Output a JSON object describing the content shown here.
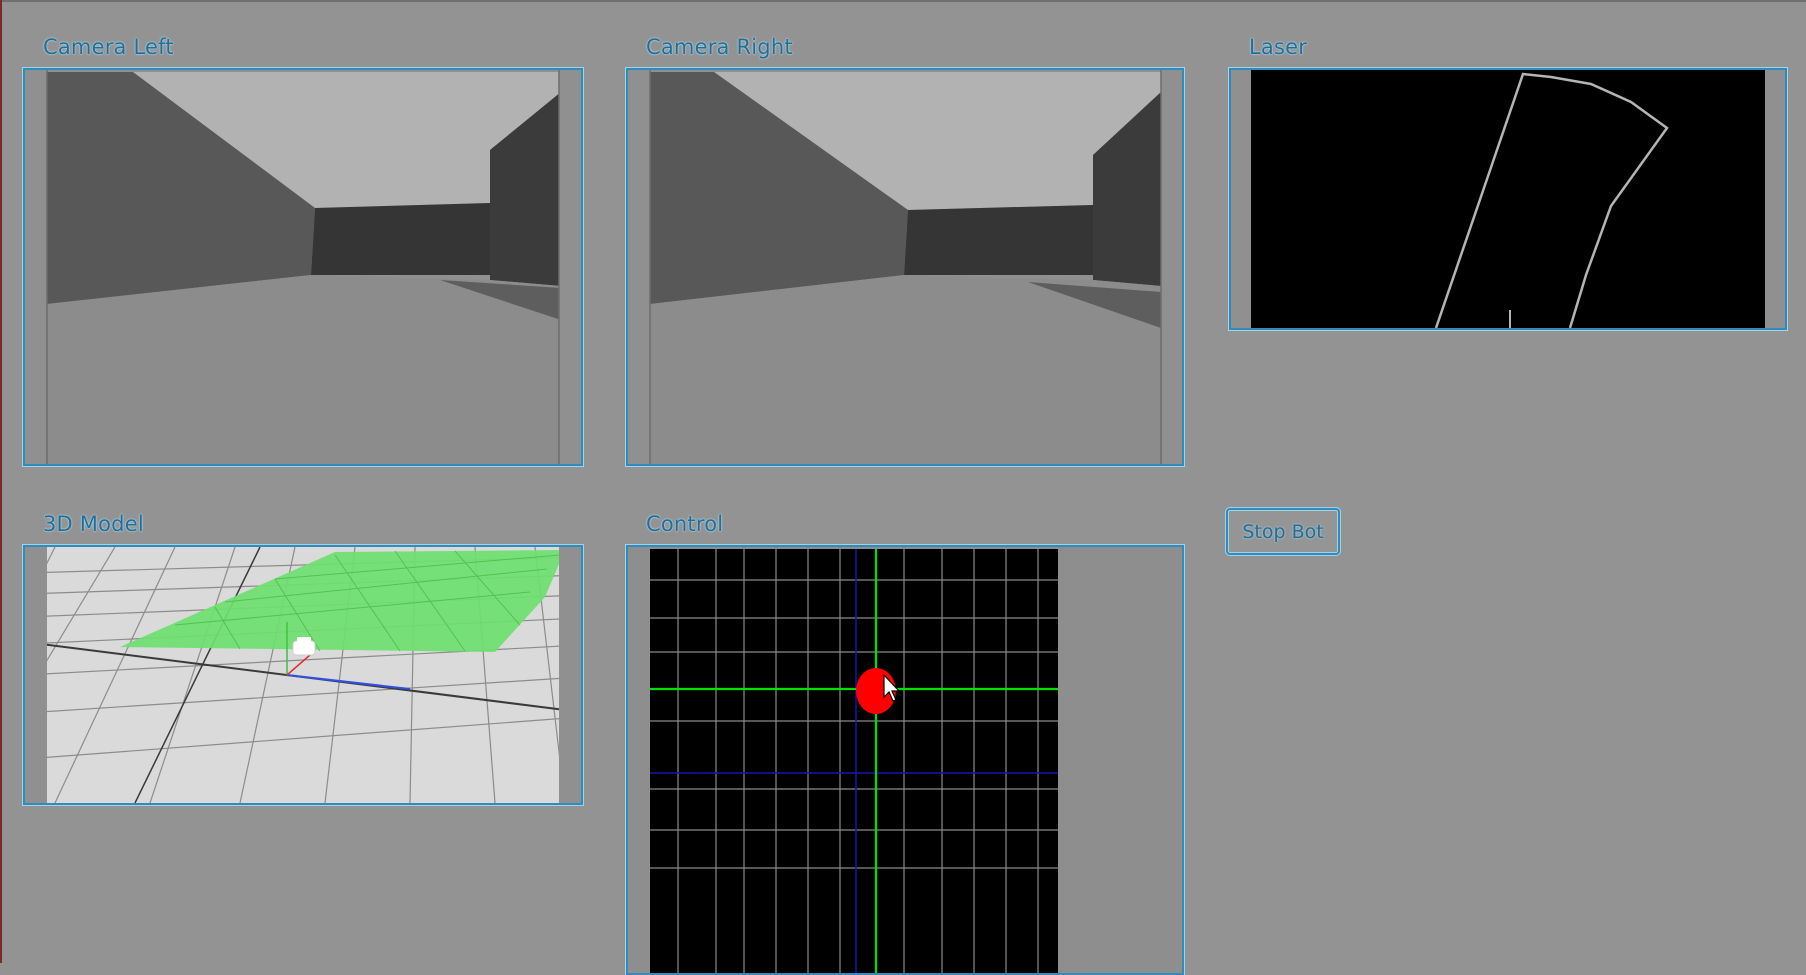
{
  "panels": {
    "camera_left": {
      "title": "Camera Left"
    },
    "camera_right": {
      "title": "Camera Right"
    },
    "laser": {
      "title": "Laser"
    },
    "model3d": {
      "title": "3D Model"
    },
    "control": {
      "title": "Control"
    }
  },
  "buttons": {
    "stop": "Stop Bot"
  },
  "colors": {
    "background": "#939393",
    "frame_border": "#2f8cbf",
    "title_text": "#1f6f9a",
    "joystick_knob": "#ff0000",
    "joystick_axis": "#00e000",
    "laser_trace": "#b4b4b4",
    "floor_highlight": "#6fe06f"
  },
  "icons": {
    "pointer": "mouse-cursor-icon",
    "robot": "robot-model-icon"
  }
}
